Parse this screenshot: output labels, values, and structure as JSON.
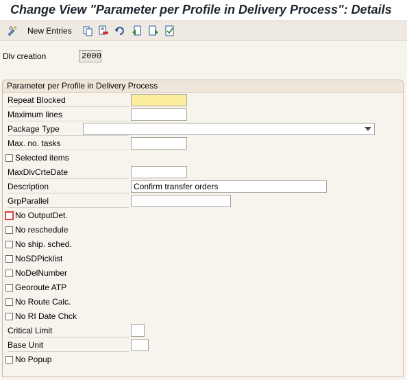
{
  "title": "Change View \"Parameter per Profile in Delivery Process\": Details",
  "toolbar": {
    "new_entries_label": "New Entries",
    "icons": [
      "display-change-icon",
      "copy-icon",
      "delete-icon",
      "undo-icon",
      "previous-entry-icon",
      "next-entry-icon",
      "select-all-icon"
    ]
  },
  "header": {
    "dlv_creation_label": "Dlv creation",
    "dlv_creation_value": "2000"
  },
  "group": {
    "title": "Parameter per Profile in Delivery Process",
    "fields": {
      "repeat_blocked": "Repeat Blocked",
      "maximum_lines": "Maximum lines",
      "package_type": "Package Type",
      "max_no_tasks": "Max. no. tasks",
      "maxdlvcrtedate": "MaxDlvCrteDate",
      "description": "Description",
      "description_value": "Confirm transfer orders",
      "grpparallel": "GrpParallel",
      "critical_limit": "Critical Limit",
      "base_unit": "Base Unit"
    },
    "checkboxes": {
      "selected_items": "Selected items",
      "no_outputdet": "No OutputDet.",
      "no_reschedule": "No reschedule",
      "no_ship_sched": "No ship. sched.",
      "nosdpicklist": "NoSDPicklist",
      "nodelnumber": "NoDelNumber",
      "georoute_atp": "Georoute ATP",
      "no_route_calc": "No Route Calc.",
      "no_ri_date_chck": "No RI Date Chck",
      "no_popup": "No Popup"
    }
  },
  "colors": {
    "background": "#f7f3ed",
    "required_field": "#fbee9e",
    "focus_outline": "#e0413c"
  }
}
